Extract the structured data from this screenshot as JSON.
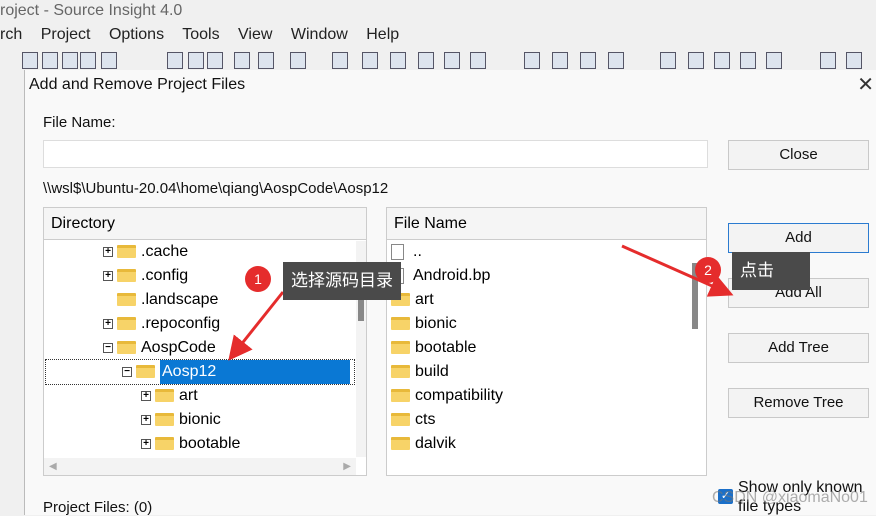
{
  "app": {
    "title": "roject - Source Insight 4.0",
    "menu": [
      "rch",
      "Project",
      "Options",
      "Tools",
      "View",
      "Window",
      "Help"
    ]
  },
  "dialog": {
    "title": "Add and Remove Project Files",
    "close_icon": "close-icon",
    "file_name_label": "File Name:",
    "file_name_value": "",
    "path": "\\\\wsl$\\Ubuntu-20.04\\home\\qiang\\AospCode\\Aosp12",
    "directory_header": "Directory",
    "directory_items": [
      {
        "label": ".cache",
        "expander": "+",
        "level": 0
      },
      {
        "label": ".config",
        "expander": "+",
        "level": 0
      },
      {
        "label": ".landscape",
        "expander": "",
        "level": 0
      },
      {
        "label": ".repoconfig",
        "expander": "+",
        "level": 0
      },
      {
        "label": "AospCode",
        "expander": "-",
        "level": 0
      },
      {
        "label": "Aosp12",
        "expander": "-",
        "level": 1,
        "selected": true
      },
      {
        "label": "art",
        "expander": "+",
        "level": 2
      },
      {
        "label": "bionic",
        "expander": "+",
        "level": 2
      },
      {
        "label": "bootable",
        "expander": "+",
        "level": 2
      }
    ],
    "file_header": "File Name",
    "file_items": [
      {
        "label": "..",
        "type": "file"
      },
      {
        "label": "Android.bp",
        "type": "file"
      },
      {
        "label": "art",
        "type": "folder"
      },
      {
        "label": "bionic",
        "type": "folder"
      },
      {
        "label": "bootable",
        "type": "folder"
      },
      {
        "label": "build",
        "type": "folder"
      },
      {
        "label": "compatibility",
        "type": "folder"
      },
      {
        "label": "cts",
        "type": "folder"
      },
      {
        "label": "dalvik",
        "type": "folder"
      }
    ],
    "buttons": {
      "close": "Close",
      "add": "Add",
      "add_all": "Add All",
      "add_tree": "Add Tree",
      "remove_tree": "Remove Tree"
    },
    "project_files": "Project Files: (0)",
    "show_known": "Show only known file types",
    "show_known_checked": true
  },
  "annotations": {
    "step1": {
      "number": "1",
      "text": "选择源码目录"
    },
    "step2": {
      "number": "2",
      "text": "点击"
    },
    "color": "#e52c2c"
  },
  "watermark": "CSDN @xiaomaNo01"
}
